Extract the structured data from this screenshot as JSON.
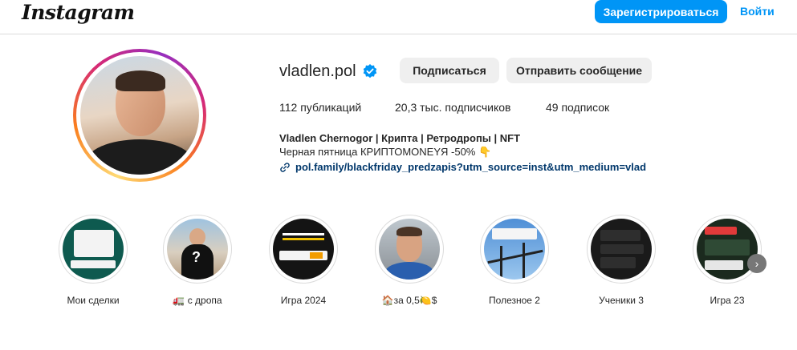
{
  "header": {
    "logo": "Instagram",
    "signup_label": "Зарегистрироваться",
    "login_label": "Войти"
  },
  "profile": {
    "username": "vladlen.pol",
    "follow_label": "Подписаться",
    "message_label": "Отправить сообщение",
    "stats": {
      "posts": "112 публикаций",
      "followers": "20,3 тыс. подписчиков",
      "following": "49 подписок"
    },
    "full_name": "Vladlen Chernogor | Крипта | Ретродропы | NFT",
    "bio": "Черная пятница КРИПТОMONEYЯ -50% 👇",
    "link": "pol.family/blackfriday_predzapis?utm_source=inst&utm_medium=vlad"
  },
  "highlights": [
    {
      "label": "Мои сделки"
    },
    {
      "label": "🚛 с дропа"
    },
    {
      "label": "Игра 2024"
    },
    {
      "label": "🏠за 0,5🍋$"
    },
    {
      "label": "Полезное 2"
    },
    {
      "label": "Ученики 3"
    },
    {
      "label": "Игра 23"
    }
  ],
  "icons": {
    "verified": "verified-badge-icon",
    "link": "link-icon",
    "next": "chevron-right-icon"
  },
  "colors": {
    "primary": "#0095f6",
    "link": "#00376b",
    "button_gray": "#efefef"
  }
}
